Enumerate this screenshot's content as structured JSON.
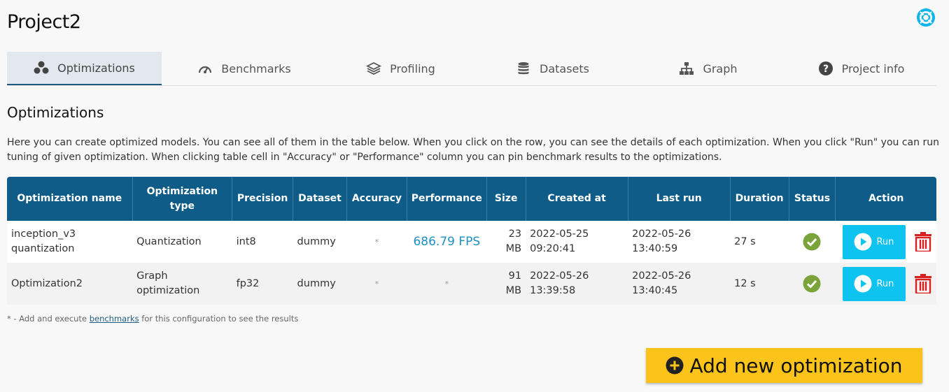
{
  "page": {
    "title": "Project2"
  },
  "tabs": [
    {
      "label": "Optimizations",
      "icon": "optimizations-icon",
      "active": true
    },
    {
      "label": "Benchmarks",
      "icon": "speedometer-icon"
    },
    {
      "label": "Profiling",
      "icon": "layers-icon"
    },
    {
      "label": "Datasets",
      "icon": "database-icon"
    },
    {
      "label": "Graph",
      "icon": "sitemap-icon"
    },
    {
      "label": "Project info",
      "icon": "question-circle-icon"
    }
  ],
  "section": {
    "title": "Optimizations",
    "description": "Here you can create optimized models. You can see all of them in the table below. When you click on the row, you can see the details of each optimization. When you click \"Run\" you can run tuning of given optimization. When clicking table cell in \"Accuracy\" or \"Performance\" column you can pin benchmark results to the optimizations."
  },
  "table": {
    "headers": {
      "name": "Optimization name",
      "type": "Optimization type",
      "precision": "Precision",
      "dataset": "Dataset",
      "accuracy": "Accuracy",
      "performance": "Performance",
      "size": "Size",
      "created": "Created at",
      "lastrun": "Last run",
      "duration": "Duration",
      "status": "Status",
      "action": "Action"
    },
    "rows": [
      {
        "name": "inception_v3 quantization",
        "type": "Quantization",
        "precision": "int8",
        "dataset": "dummy",
        "accuracy": "*",
        "performance": "686.79 FPS",
        "size": "23 MB",
        "created": "2022-05-25 09:20:41",
        "lastrun": "2022-05-26 13:40:59",
        "duration": "27 s",
        "status": "success",
        "run_label": "Run"
      },
      {
        "name": "Optimization2",
        "type": "Graph optimization",
        "precision": "fp32",
        "dataset": "dummy",
        "accuracy": "*",
        "performance": "*",
        "size": "91 MB",
        "created": "2022-05-26 13:39:58",
        "lastrun": "2022-05-26 13:40:45",
        "duration": "12 s",
        "status": "success",
        "run_label": "Run"
      }
    ]
  },
  "footnote": {
    "prefix": "* - Add and execute",
    "link": "benchmarks",
    "suffix": "for this configuration to see the results"
  },
  "add_button": {
    "label": "Add new optimization"
  },
  "colors": {
    "header_bg": "#0e5c87",
    "run_button": "#0ec3f0",
    "add_button": "#fcc41a",
    "status_ok": "#7aa43a",
    "delete": "#d92020",
    "link": "#1d8fc2"
  }
}
